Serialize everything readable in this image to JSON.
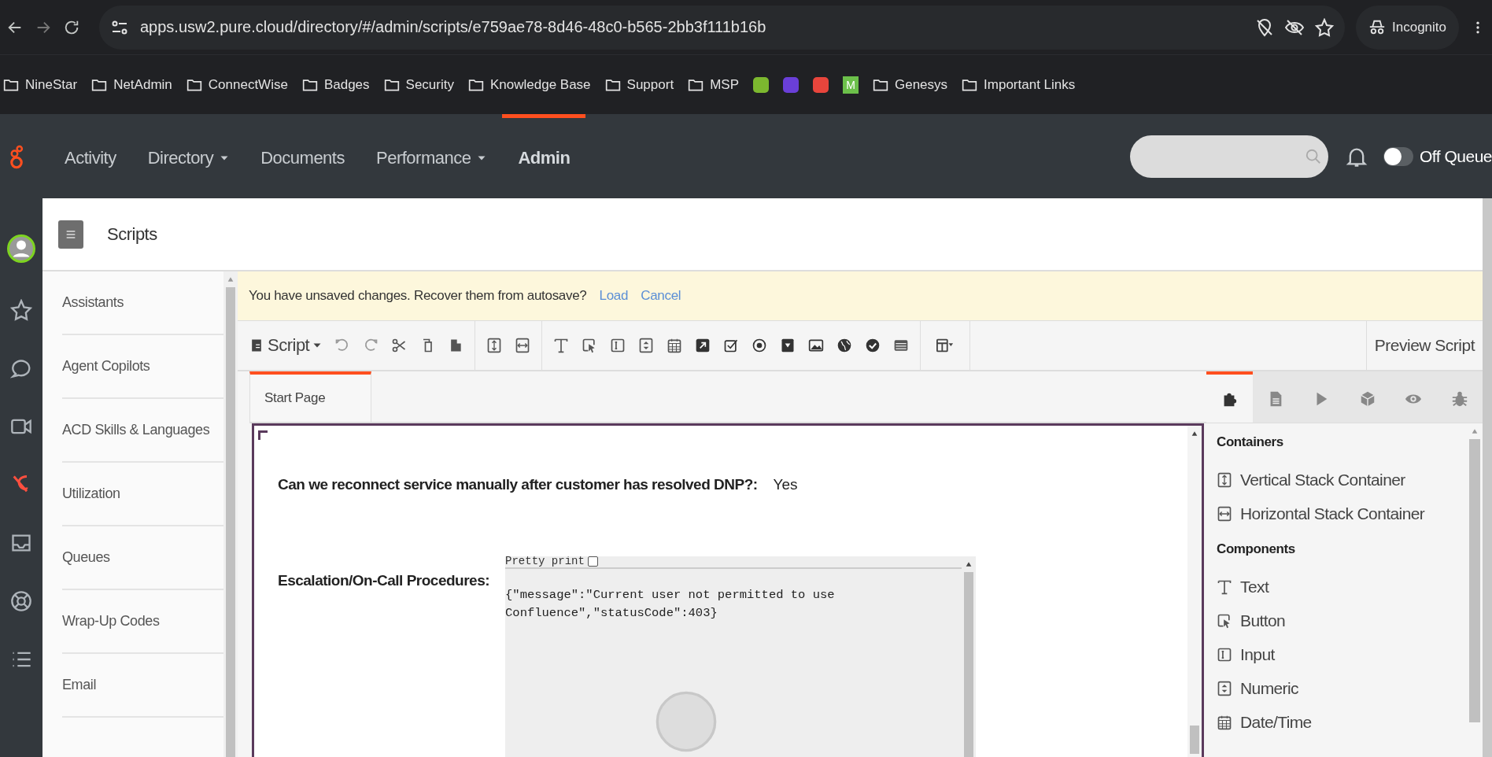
{
  "browser": {
    "url": "apps.usw2.pure.cloud/directory/#/admin/scripts/e759ae78-8d46-48c0-b565-2bb3f111b16b",
    "profile": "Incognito"
  },
  "bookmarks": [
    {
      "kind": "folder",
      "label": "NineStar"
    },
    {
      "kind": "folder",
      "label": "NetAdmin"
    },
    {
      "kind": "folder",
      "label": "ConnectWise"
    },
    {
      "kind": "folder",
      "label": "Badges"
    },
    {
      "kind": "folder",
      "label": "Security"
    },
    {
      "kind": "folder",
      "label": "Knowledge Base"
    },
    {
      "kind": "folder",
      "label": "Support"
    },
    {
      "kind": "folder",
      "label": "MSP"
    },
    {
      "kind": "app",
      "color": "#7cb82f"
    },
    {
      "kind": "app",
      "color": "#6a3fd8"
    },
    {
      "kind": "app",
      "color": "#e8453c"
    },
    {
      "kind": "letter",
      "label": "M",
      "color": "#6cc04a"
    },
    {
      "kind": "folder",
      "label": "Genesys"
    },
    {
      "kind": "folder",
      "label": "Important Links"
    }
  ],
  "nav": [
    {
      "label": "Activity",
      "dropdown": false,
      "selected": false
    },
    {
      "label": "Directory",
      "dropdown": true,
      "selected": false
    },
    {
      "label": "Documents",
      "dropdown": false,
      "selected": false
    },
    {
      "label": "Performance",
      "dropdown": true,
      "selected": false
    },
    {
      "label": "Admin",
      "dropdown": false,
      "selected": true
    }
  ],
  "queue": {
    "label": "Off Queue",
    "on": false
  },
  "rail": [
    {
      "kind": "avatar"
    },
    {
      "kind": "star"
    },
    {
      "kind": "chat"
    },
    {
      "kind": "video"
    },
    {
      "kind": "script"
    },
    {
      "kind": "inbox"
    },
    {
      "kind": "lifebuoy"
    },
    {
      "kind": "list"
    }
  ],
  "page_title": "Scripts",
  "sidebar": {
    "items": [
      "Assistants",
      "Agent Copilots",
      "ACD Skills & Languages",
      "Utilization",
      "Queues",
      "Wrap-Up Codes",
      "Email"
    ]
  },
  "banner": {
    "message": "You have unsaved changes. Recover them from autosave?",
    "actions": [
      "Load",
      "Cancel"
    ]
  },
  "toolbar": {
    "script_menu": "Script",
    "preview": "Preview Script"
  },
  "page_tabs": [
    {
      "label": "Start Page",
      "selected": true
    }
  ],
  "canvas": {
    "fields": [
      {
        "kind": "text",
        "label": "Can we reconnect service manually after customer has resolved DNP?:",
        "value": "Yes"
      },
      {
        "kind": "web",
        "label": "Escalation/On-Call Procedures:",
        "pretty_print": "Pretty print",
        "pretty_checked": false,
        "content": "{\"message\":\"Current user not permitted to use Confluence\",\"statusCode\":403}"
      }
    ]
  },
  "palette": {
    "tabs": [
      {
        "kind": "components",
        "selected": true
      },
      {
        "kind": "pages",
        "selected": false
      },
      {
        "kind": "actions",
        "selected": false
      },
      {
        "kind": "variables",
        "selected": false
      },
      {
        "kind": "preview",
        "selected": false
      },
      {
        "kind": "debug",
        "selected": false
      }
    ],
    "sections": [
      {
        "title": "Containers",
        "items": [
          {
            "kind": "vstack",
            "label": "Vertical Stack Container"
          },
          {
            "kind": "hstack",
            "label": "Horizontal Stack Container"
          }
        ]
      },
      {
        "title": "Components",
        "items": [
          {
            "kind": "text",
            "label": "Text"
          },
          {
            "kind": "button",
            "label": "Button"
          },
          {
            "kind": "input",
            "label": "Input"
          },
          {
            "kind": "numeric",
            "label": "Numeric"
          },
          {
            "kind": "datetime",
            "label": "Date/Time"
          }
        ]
      }
    ]
  }
}
